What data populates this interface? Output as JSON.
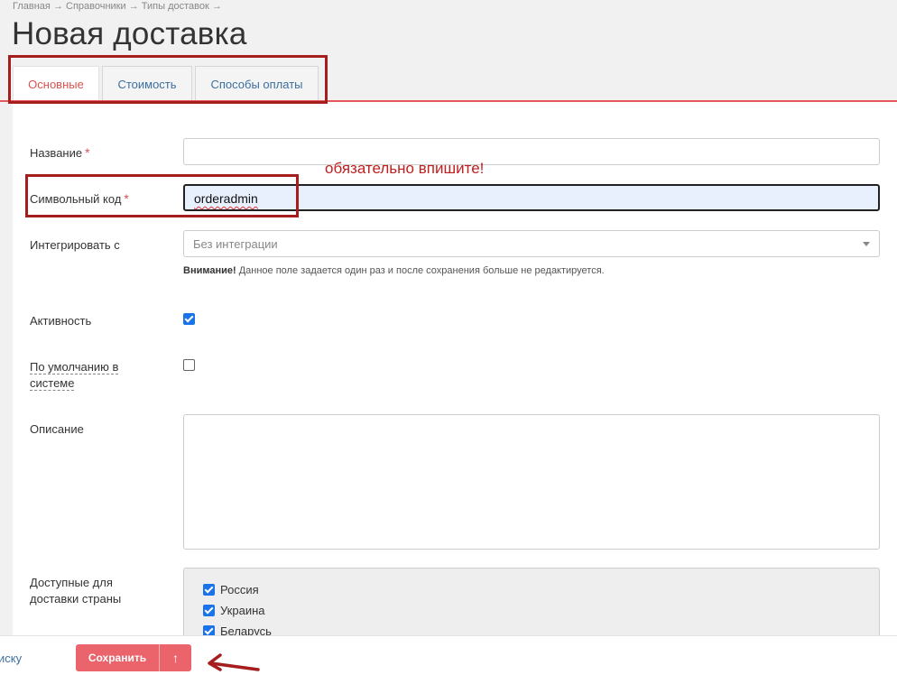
{
  "breadcrumb": {
    "items": [
      "Главная",
      "Справочники",
      "Типы доставок"
    ],
    "separator": "→"
  },
  "page_title": "Новая доставка",
  "tabs": [
    {
      "label": "Основные",
      "active": true
    },
    {
      "label": "Стоимость",
      "active": false
    },
    {
      "label": "Способы оплаты",
      "active": false
    }
  ],
  "form": {
    "name": {
      "label": "Название",
      "value": "",
      "required": true
    },
    "code": {
      "label": "Символьный код",
      "value": "orderadmin",
      "required": true
    },
    "integration": {
      "label": "Интегрировать с",
      "placeholder": "Без интеграции"
    },
    "hint": {
      "bold": "Внимание!",
      "text": "Данное поле задается один раз и после сохранения больше не редактируется."
    },
    "active": {
      "label": "Активность",
      "checked": true
    },
    "default": {
      "label_line1": "По умолчанию в",
      "label_line2": "системе",
      "checked": false
    },
    "description": {
      "label": "Описание",
      "value": ""
    },
    "countries": {
      "label_line1": "Доступные для",
      "label_line2": "доставки страны",
      "items": [
        {
          "name": "Россия",
          "checked": true
        },
        {
          "name": "Украина",
          "checked": true
        },
        {
          "name": "Беларусь",
          "checked": true
        }
      ]
    }
  },
  "annotation": {
    "text": "обязательно впишите!",
    "color": "#c0201f"
  },
  "footer": {
    "back_link": "иску",
    "save_label": "Сохранить",
    "save_up_icon": "↑"
  },
  "colors": {
    "accent": "#e6585b",
    "button": "#eb646c",
    "link": "#3d6f9f",
    "checkbox": "#1a73e8"
  }
}
